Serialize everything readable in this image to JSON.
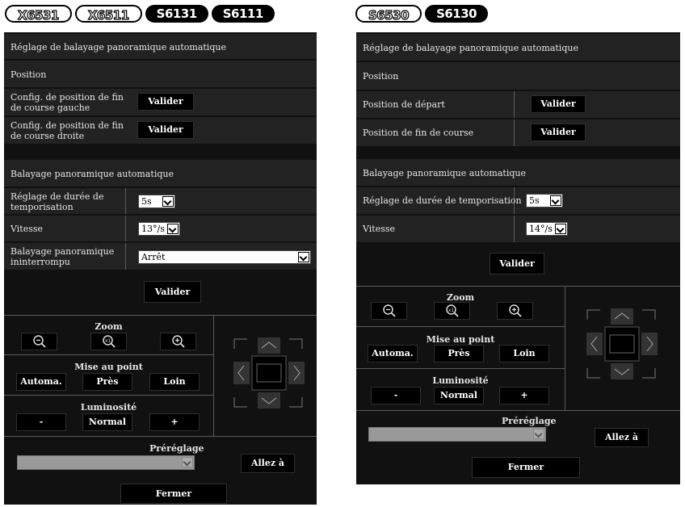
{
  "badges_left": [
    "X6531",
    "X6511",
    "S6131",
    "S6111"
  ],
  "badges_right": [
    "S6530",
    "S6130"
  ],
  "left": {
    "title": "Réglage de balayage panoramique automatique",
    "position_header": "Position",
    "left_end_label": "Config. de position de fin de course gauche",
    "right_end_label": "Config. de position de fin de course droite",
    "apply": "Valider",
    "autopan_header": "Balayage panoramique automatique",
    "dwell_label": "Réglage de durée de temporisation",
    "dwell_value": "5s",
    "speed_label": "Vitesse",
    "speed_value": "13°/s",
    "endless_label": "Balayage panoramique ininterrompu",
    "endless_value": "Arrêt",
    "zoom_label": "Zoom",
    "focus_label": "Mise au point",
    "focus_auto": "Automa.",
    "focus_near": "Près",
    "focus_far": "Loin",
    "brightness_label": "Luminosité",
    "brightness_minus": "-",
    "brightness_normal": "Normal",
    "brightness_plus": "+",
    "preset_label": "Préréglage",
    "goto": "Allez à",
    "close": "Fermer"
  },
  "right": {
    "title": "Réglage de balayage panoramique automatique",
    "position_header": "Position",
    "start_label": "Position de départ",
    "end_label": "Position de fin de course",
    "apply": "Valider",
    "autopan_header": "Balayage panoramique automatique",
    "dwell_label": "Réglage de durée de temporisation",
    "dwell_value": "5s",
    "speed_label": "Vitesse",
    "speed_value": "14°/s",
    "zoom_label": "Zoom",
    "focus_label": "Mise au point",
    "focus_auto": "Automa.",
    "focus_near": "Près",
    "focus_far": "Loin",
    "brightness_label": "Luminosité",
    "brightness_minus": "-",
    "brightness_normal": "Normal",
    "brightness_plus": "+",
    "preset_label": "Préréglage",
    "goto": "Allez à",
    "close": "Fermer"
  },
  "colors": {
    "panel_bg": "#111111",
    "row_bg": "#222222",
    "button_bg": "#000000",
    "text": "#e6e6e6"
  }
}
